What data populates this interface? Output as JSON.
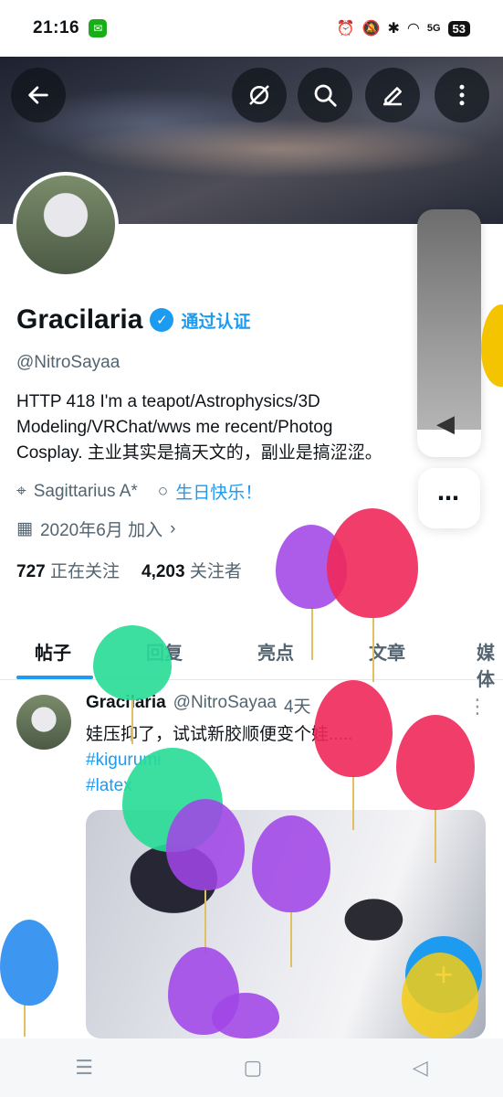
{
  "status_bar": {
    "time": "21:16",
    "battery": "53",
    "network": "5G"
  },
  "header": {
    "back": "back",
    "icons": [
      "mute-icon",
      "search-icon",
      "edit-icon",
      "more-icon"
    ]
  },
  "profile": {
    "name": "Gracilaria",
    "verified_label": "通过认证",
    "handle": "@NitroSayaa",
    "bio_line1": "HTTP 418 I'm a teapot/Astrophysics/3D",
    "bio_line2": "Modeling/VRChat/wws me recent/Photog",
    "bio_line3": "Cosplay. 主业其实是搞天文的，副业是搞涩涩。",
    "location": "Sagittarius A*",
    "birthday": "生日快乐！",
    "joined": "2020年6月 加入",
    "following_count": "727",
    "following_label": "正在关注",
    "followers_count": "4,203",
    "followers_label": "关注者"
  },
  "tabs": [
    "帖子",
    "回复",
    "亮点",
    "文章",
    "媒体"
  ],
  "tweet": {
    "name": "Gracilaria",
    "handle": "@NitroSayaa",
    "time": "4天",
    "text": "娃压抑了，试试新胶顺便变个娃.....",
    "tag1": "#kigurumi",
    "tag2": "#latex"
  },
  "fab_label": "+",
  "nav": [
    "menu",
    "home",
    "back"
  ],
  "colors": {
    "accent": "#1d9bf0",
    "text": "#0f1419",
    "muted": "#536471"
  }
}
